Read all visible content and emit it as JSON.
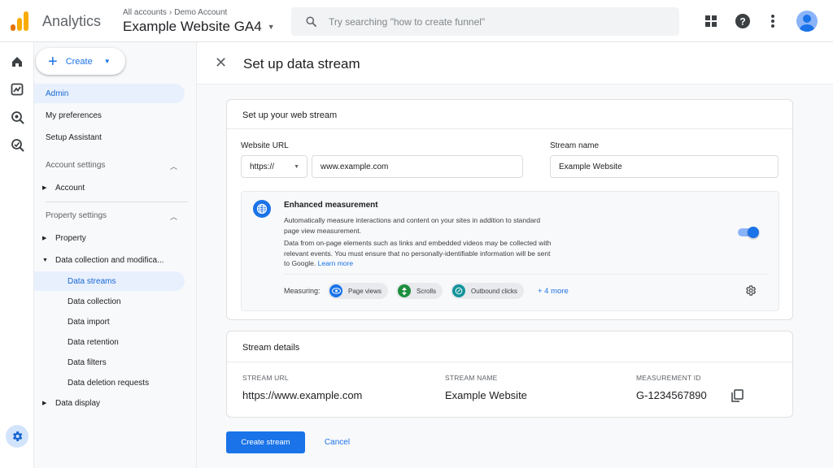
{
  "app": {
    "name": "Analytics"
  },
  "header": {
    "breadcrumb": {
      "all_accounts": "All accounts",
      "separator": "›",
      "account": "Demo Account"
    },
    "property_title": "Example Website GA4",
    "search_placeholder": "Try searching \"how to create funnel\""
  },
  "topbar_icons": [
    "apps-grid-icon",
    "help-icon",
    "more-vert-icon",
    "account-avatar"
  ],
  "rail": [
    "home-icon",
    "reports-icon",
    "explore-icon",
    "advertising-icon",
    "admin-gear-icon"
  ],
  "nav": {
    "create_label": "Create",
    "admin": "Admin",
    "my_preferences": "My preferences",
    "setup_assistant": "Setup Assistant",
    "account_settings": "Account settings",
    "account": "Account",
    "property_settings": "Property settings",
    "property": "Property",
    "data_collection_modification": "Data collection and modifica...",
    "data_streams": "Data streams",
    "data_collection": "Data collection",
    "data_import": "Data import",
    "data_retention": "Data retention",
    "data_filters": "Data filters",
    "data_deletion_requests": "Data deletion requests",
    "data_display": "Data display"
  },
  "page": {
    "title": "Set up data stream",
    "web_stream": {
      "heading": "Set up your web stream",
      "website_url_label": "Website URL",
      "protocol": "https://",
      "url_value": "www.example.com",
      "stream_name_label": "Stream name",
      "stream_name_value": "Example Website"
    },
    "enhanced": {
      "title": "Enhanced measurement",
      "desc1_line1": "Automatically measure interactions and content on your sites in addition to standard",
      "desc1_line2": "page view measurement.",
      "desc2_line1": "Data from on-page elements such as links and embedded videos may be collected with",
      "desc2_line2": "relevant events. You must ensure that no personally-identifiable information will be sent",
      "desc2_line3": "to Google.",
      "learn_more": "Learn more",
      "toggle_on": true,
      "measuring_label": "Measuring:",
      "chips": [
        {
          "label": "Page views",
          "color": "#1a73e8"
        },
        {
          "label": "Scrolls",
          "color": "#1e8e3e"
        },
        {
          "label": "Outbound clicks",
          "color": "#12939a"
        }
      ],
      "more": "+ 4 more"
    },
    "stream_details": {
      "heading": "Stream details",
      "url_header": "STREAM URL",
      "url_value": "https://www.example.com",
      "name_header": "STREAM NAME",
      "name_value": "Example Website",
      "id_header": "MEASUREMENT ID",
      "id_value": "G-1234567890"
    },
    "actions": {
      "create": "Create stream",
      "cancel": "Cancel"
    }
  },
  "colors": {
    "accent": "#1a73e8",
    "active_nav_bg": "#e8f0fe"
  }
}
